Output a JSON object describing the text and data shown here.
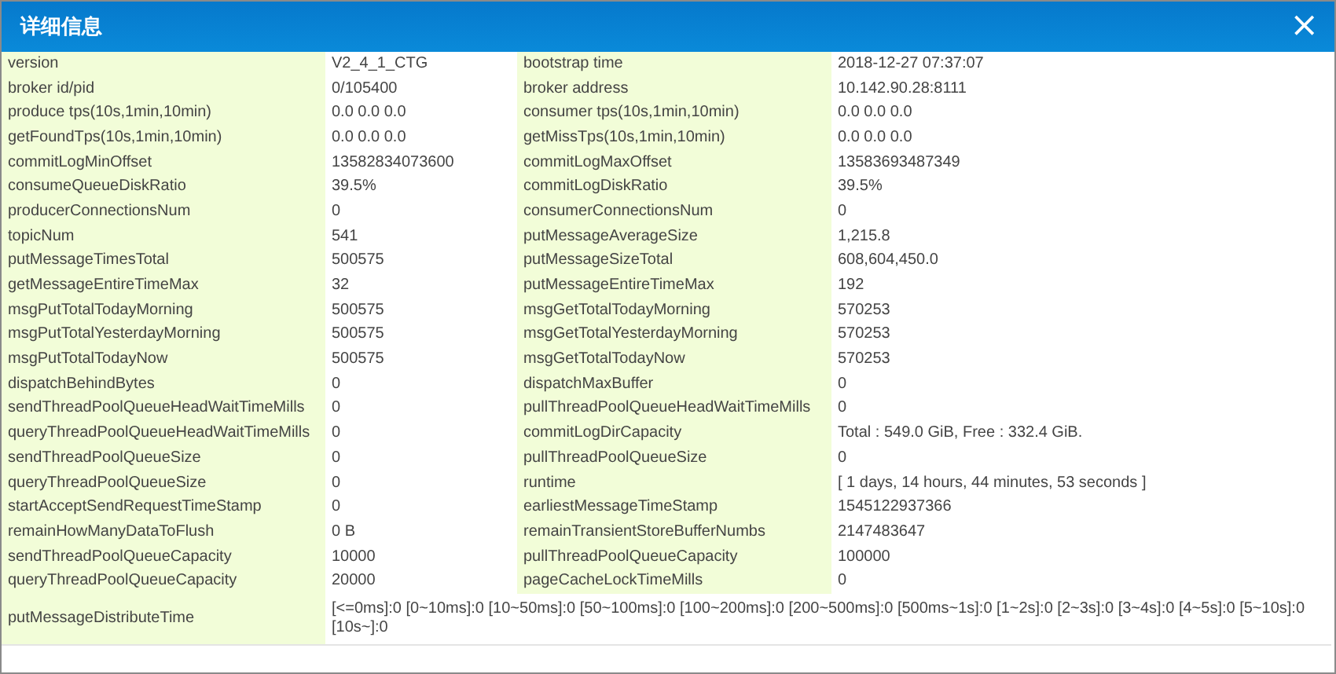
{
  "dialog": {
    "title": "详细信息",
    "close_icon": "×"
  },
  "rows": [
    {
      "pairs": [
        {
          "label": "version",
          "value": "V2_4_1_CTG"
        },
        {
          "label": "bootstrap time",
          "value": "2018-12-27 07:37:07"
        }
      ]
    },
    {
      "pairs": [
        {
          "label": "broker id/pid",
          "value": "0/105400"
        },
        {
          "label": "broker address",
          "value": "10.142.90.28:8111"
        }
      ]
    },
    {
      "pairs": [
        {
          "label": "produce tps(10s,1min,10min)",
          "value": "0.0 0.0 0.0"
        },
        {
          "label": "consumer tps(10s,1min,10min)",
          "value": "0.0 0.0 0.0"
        }
      ]
    },
    {
      "pairs": [
        {
          "label": "getFoundTps(10s,1min,10min)",
          "value": "0.0 0.0 0.0"
        },
        {
          "label": "getMissTps(10s,1min,10min)",
          "value": "0.0 0.0 0.0"
        }
      ]
    },
    {
      "pairs": [
        {
          "label": "commitLogMinOffset",
          "value": "13582834073600"
        },
        {
          "label": "commitLogMaxOffset",
          "value": "13583693487349"
        }
      ]
    },
    {
      "pairs": [
        {
          "label": "consumeQueueDiskRatio",
          "value": "39.5%"
        },
        {
          "label": "commitLogDiskRatio",
          "value": "39.5%"
        }
      ]
    },
    {
      "pairs": [
        {
          "label": "producerConnectionsNum",
          "value": "0"
        },
        {
          "label": "consumerConnectionsNum",
          "value": "0"
        }
      ]
    },
    {
      "pairs": [
        {
          "label": "topicNum",
          "value": "541"
        },
        {
          "label": "putMessageAverageSize",
          "value": "1,215.8"
        }
      ]
    },
    {
      "pairs": [
        {
          "label": "putMessageTimesTotal",
          "value": "500575"
        },
        {
          "label": "putMessageSizeTotal",
          "value": "608,604,450.0"
        }
      ]
    },
    {
      "pairs": [
        {
          "label": "getMessageEntireTimeMax",
          "value": "32"
        },
        {
          "label": "putMessageEntireTimeMax",
          "value": "192"
        }
      ]
    },
    {
      "pairs": [
        {
          "label": "msgPutTotalTodayMorning",
          "value": "500575"
        },
        {
          "label": "msgGetTotalTodayMorning",
          "value": "570253"
        }
      ]
    },
    {
      "pairs": [
        {
          "label": "msgPutTotalYesterdayMorning",
          "value": "500575"
        },
        {
          "label": "msgGetTotalYesterdayMorning",
          "value": "570253"
        }
      ]
    },
    {
      "pairs": [
        {
          "label": "msgPutTotalTodayNow",
          "value": "500575"
        },
        {
          "label": "msgGetTotalTodayNow",
          "value": "570253"
        }
      ]
    },
    {
      "pairs": [
        {
          "label": "dispatchBehindBytes",
          "value": "0"
        },
        {
          "label": "dispatchMaxBuffer",
          "value": "0"
        }
      ]
    },
    {
      "pairs": [
        {
          "label": "sendThreadPoolQueueHeadWaitTimeMills",
          "value": "0"
        },
        {
          "label": "pullThreadPoolQueueHeadWaitTimeMills",
          "value": "0"
        }
      ]
    },
    {
      "pairs": [
        {
          "label": "queryThreadPoolQueueHeadWaitTimeMills",
          "value": "0"
        },
        {
          "label": "commitLogDirCapacity",
          "value": "Total : 549.0 GiB, Free : 332.4 GiB."
        }
      ]
    },
    {
      "pairs": [
        {
          "label": "sendThreadPoolQueueSize",
          "value": "0"
        },
        {
          "label": "pullThreadPoolQueueSize",
          "value": "0"
        }
      ]
    },
    {
      "pairs": [
        {
          "label": "queryThreadPoolQueueSize",
          "value": "0"
        },
        {
          "label": "runtime",
          "value": "[ 1 days, 14 hours, 44 minutes, 53 seconds ]"
        }
      ]
    },
    {
      "pairs": [
        {
          "label": "startAcceptSendRequestTimeStamp",
          "value": "0"
        },
        {
          "label": "earliestMessageTimeStamp",
          "value": "1545122937366"
        }
      ]
    },
    {
      "pairs": [
        {
          "label": "remainHowManyDataToFlush",
          "value": "0 B"
        },
        {
          "label": "remainTransientStoreBufferNumbs",
          "value": "2147483647"
        }
      ]
    },
    {
      "pairs": [
        {
          "label": "sendThreadPoolQueueCapacity",
          "value": "10000"
        },
        {
          "label": "pullThreadPoolQueueCapacity",
          "value": "100000"
        }
      ]
    },
    {
      "pairs": [
        {
          "label": "queryThreadPoolQueueCapacity",
          "value": "20000"
        },
        {
          "label": "pageCacheLockTimeMills",
          "value": "0"
        }
      ]
    },
    {
      "pairs": [
        {
          "label": "putMessageDistributeTime",
          "value": "[<=0ms]:0 [0~10ms]:0 [10~50ms]:0 [50~100ms]:0 [100~200ms]:0 [200~500ms]:0 [500ms~1s]:0 [1~2s]:0 [2~3s]:0 [3~4s]:0 [4~5s]:0 [5~10s]:0 [10s~]:0"
        }
      ]
    }
  ]
}
